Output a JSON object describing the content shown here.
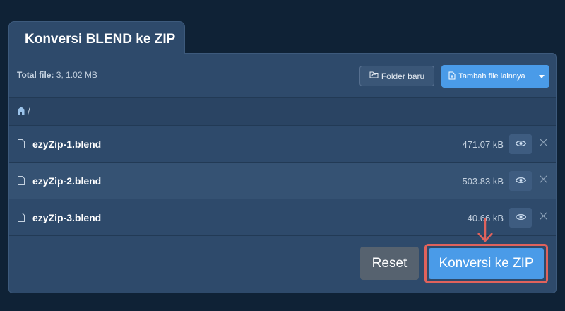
{
  "header": {
    "title": "Konversi BLEND ke ZIP"
  },
  "toolbar": {
    "total_label": "Total file:",
    "total_value": "3, 1.02 MB",
    "new_folder_label": "Folder baru",
    "add_files_label": "Tambah file lainnya"
  },
  "breadcrumb": {
    "separator": "/"
  },
  "files": [
    {
      "name": "ezyZip-1.blend",
      "size": "471.07 kB"
    },
    {
      "name": "ezyZip-2.blend",
      "size": "503.83 kB"
    },
    {
      "name": "ezyZip-3.blend",
      "size": "40.66 kB"
    }
  ],
  "actions": {
    "reset_label": "Reset",
    "convert_label": "Konversi ke ZIP"
  },
  "colors": {
    "background": "#0f2236",
    "panel": "#2e4a6b",
    "accent": "#4a9be8",
    "highlight": "#e0625c",
    "reset": "#56626f"
  },
  "icons": {
    "breadcrumb": "home-icon",
    "new_folder": "folder-refresh-icon",
    "add_files": "file-plus-icon",
    "file": "file-icon",
    "preview": "eye-icon",
    "remove": "close-icon",
    "callout": "arrow-down-icon"
  }
}
